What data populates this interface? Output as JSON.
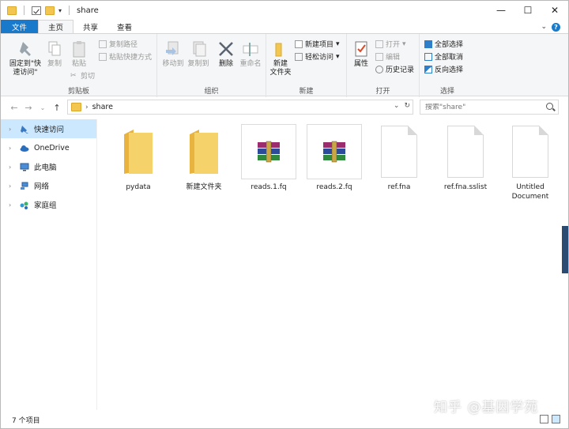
{
  "window": {
    "title": "share"
  },
  "window_controls": {
    "minimize": "—",
    "maximize": "☐",
    "close": "✕"
  },
  "tabs": [
    {
      "label": "文件"
    },
    {
      "label": "主页"
    },
    {
      "label": "共享"
    },
    {
      "label": "查看"
    }
  ],
  "ribbon": {
    "clipboard": {
      "pin": "固定到\"快",
      "pin2": "速访问\"",
      "copy": "复制",
      "paste": "粘贴",
      "copy_path": "复制路径",
      "paste_shortcut": "粘贴快捷方式",
      "cut": "剪切",
      "label": "剪贴板"
    },
    "organize": {
      "move_to": "移动到",
      "copy_to": "复制到",
      "delete": "删除",
      "rename": "重命名",
      "label": "组织"
    },
    "new": {
      "new_folder": "新建",
      "new_folder2": "文件夹",
      "new_item": "新建项目",
      "easy_access": "轻松访问",
      "label": "新建"
    },
    "open": {
      "properties": "属性",
      "open": "打开",
      "edit": "编辑",
      "history": "历史记录",
      "label": "打开"
    },
    "select": {
      "select_all": "全部选择",
      "select_none": "全部取消",
      "invert": "反向选择",
      "label": "选择"
    }
  },
  "address": {
    "path": "share"
  },
  "search": {
    "placeholder": "搜索\"share\""
  },
  "sidebar": {
    "items": [
      {
        "label": "快速访问"
      },
      {
        "label": "OneDrive"
      },
      {
        "label": "此电脑"
      },
      {
        "label": "网络"
      },
      {
        "label": "家庭组"
      }
    ]
  },
  "files": [
    {
      "name": "pydata",
      "type": "folder"
    },
    {
      "name": "新建文件夹",
      "type": "folder"
    },
    {
      "name": "reads.1.fq",
      "type": "archive"
    },
    {
      "name": "reads.2.fq",
      "type": "archive"
    },
    {
      "name": "ref.fna",
      "type": "file"
    },
    {
      "name": "ref.fna.sslist",
      "type": "file"
    },
    {
      "name": "Untitled Document",
      "type": "file"
    }
  ],
  "status": {
    "count": "7 个项目"
  },
  "watermark": "知乎 @基因学苑"
}
